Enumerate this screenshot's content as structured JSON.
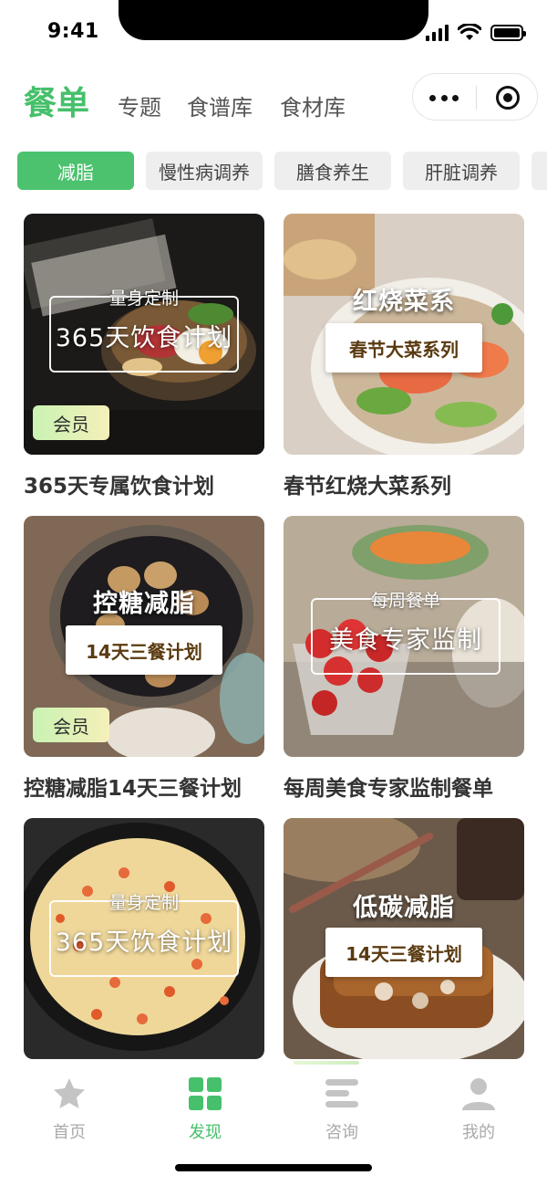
{
  "status_bar": {
    "time": "9:41"
  },
  "header": {
    "title": "餐单",
    "tabs": [
      {
        "label": "专题"
      },
      {
        "label": "食谱库"
      },
      {
        "label": "食材库"
      }
    ]
  },
  "categories": [
    {
      "label": "减脂",
      "active": true
    },
    {
      "label": "慢性病调养"
    },
    {
      "label": "膳食养生"
    },
    {
      "label": "肝脏调养"
    }
  ],
  "cards": [
    {
      "title": "365天专属饮食计划",
      "overlay_top": "量身定制",
      "overlay_main": "365天饮食计划",
      "badge": "会员"
    },
    {
      "title": "春节红烧大菜系列",
      "overlay_big": "红烧菜系",
      "overlay_box": "春节大菜系列"
    },
    {
      "title": "控糖减脂14天三餐计划",
      "overlay_big": "控糖减脂",
      "overlay_box": "14天三餐计划",
      "badge": "会员"
    },
    {
      "title": "每周美食专家监制餐单",
      "overlay_top": "每周餐单",
      "overlay_main": "美食专家监制"
    },
    {
      "overlay_top": "量身定制",
      "overlay_main": "365天饮食计划"
    },
    {
      "overlay_big": "低碳减脂",
      "overlay_box": "14天三餐计划"
    }
  ],
  "tabbar": [
    {
      "label": "首页",
      "icon": "star-icon"
    },
    {
      "label": "发现",
      "icon": "grid-icon",
      "active": true
    },
    {
      "label": "咨询",
      "icon": "chat-lines-icon"
    },
    {
      "label": "我的",
      "icon": "person-icon"
    }
  ],
  "colors": {
    "accent": "#46c06a",
    "chip_bg": "#eeeeee",
    "badge_gradient": [
      "#c9f2b4",
      "#f5f0b8"
    ]
  }
}
